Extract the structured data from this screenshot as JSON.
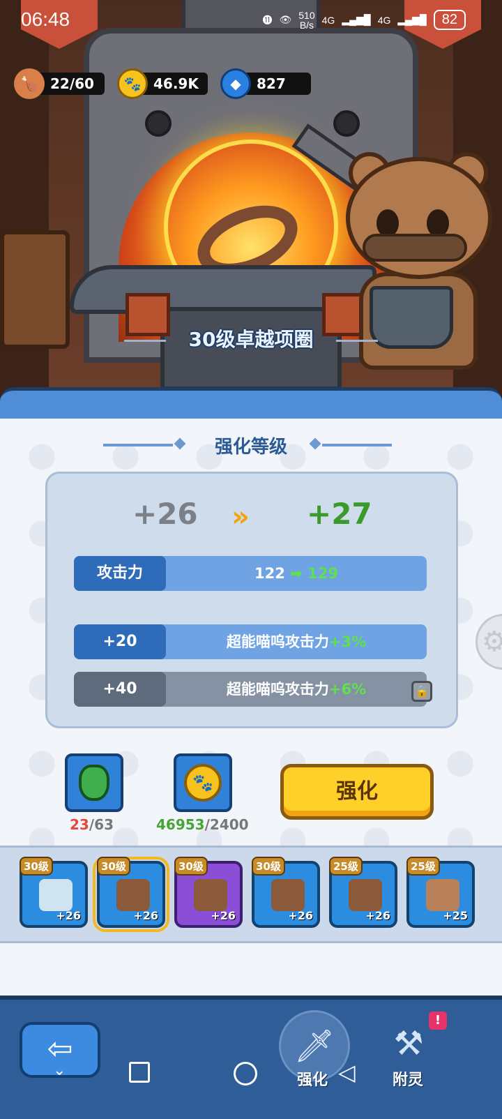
{
  "status_bar": {
    "time": "06:48",
    "net_speed_value": "510",
    "net_speed_unit": "B/s",
    "signal_1": "4G",
    "signal_2": "4G",
    "battery": "82"
  },
  "resources": {
    "stamina": "22/60",
    "coins": "46.9K",
    "gems": "827"
  },
  "item": {
    "title": "30级卓越项圈"
  },
  "enhance_panel": {
    "section_title": "强化等级",
    "level_from": "+26",
    "level_arrow": "»",
    "level_to": "+27",
    "stats": [
      {
        "label": "攻击力",
        "from": "122",
        "to": "129"
      }
    ],
    "bonuses": [
      {
        "label": "+20",
        "text": "超能喵呜攻击力",
        "value": "+3%",
        "locked": false
      },
      {
        "label": "+40",
        "text": "超能喵呜攻击力",
        "value": "+6%",
        "locked": true
      }
    ],
    "costs": [
      {
        "icon": "green-stone-icon",
        "have": "23",
        "need": "/63"
      },
      {
        "icon": "paw-coin-icon",
        "have": "46953",
        "need": "/2400"
      }
    ],
    "enhance_button": "强化"
  },
  "equipment": [
    {
      "level": "30级",
      "plus": "+26",
      "icon": "crown-icon",
      "rarity": "blue",
      "selected": false
    },
    {
      "level": "30级",
      "plus": "+26",
      "icon": "collar-icon",
      "rarity": "blue",
      "selected": true
    },
    {
      "level": "30级",
      "plus": "+26",
      "icon": "fur-coat-icon",
      "rarity": "purple",
      "selected": false
    },
    {
      "level": "30级",
      "plus": "+26",
      "icon": "fur-glove-icon",
      "rarity": "blue",
      "selected": false
    },
    {
      "level": "25级",
      "plus": "+26",
      "icon": "leather-coat-icon",
      "rarity": "blue",
      "selected": false
    },
    {
      "level": "25级",
      "plus": "+25",
      "icon": "boot-icon",
      "rarity": "blue",
      "selected": false
    }
  ],
  "bottom_nav": {
    "enhance_tab": "强化",
    "spirit_tab": "附灵",
    "spirit_alert": "!"
  },
  "colors": {
    "panel_blue": "#4f8ed6",
    "stat_bar": "#6fa3e4",
    "positive_green": "#5fe04e",
    "insufficient_red": "#e2473c",
    "button_yellow": "#ffcf2a"
  }
}
